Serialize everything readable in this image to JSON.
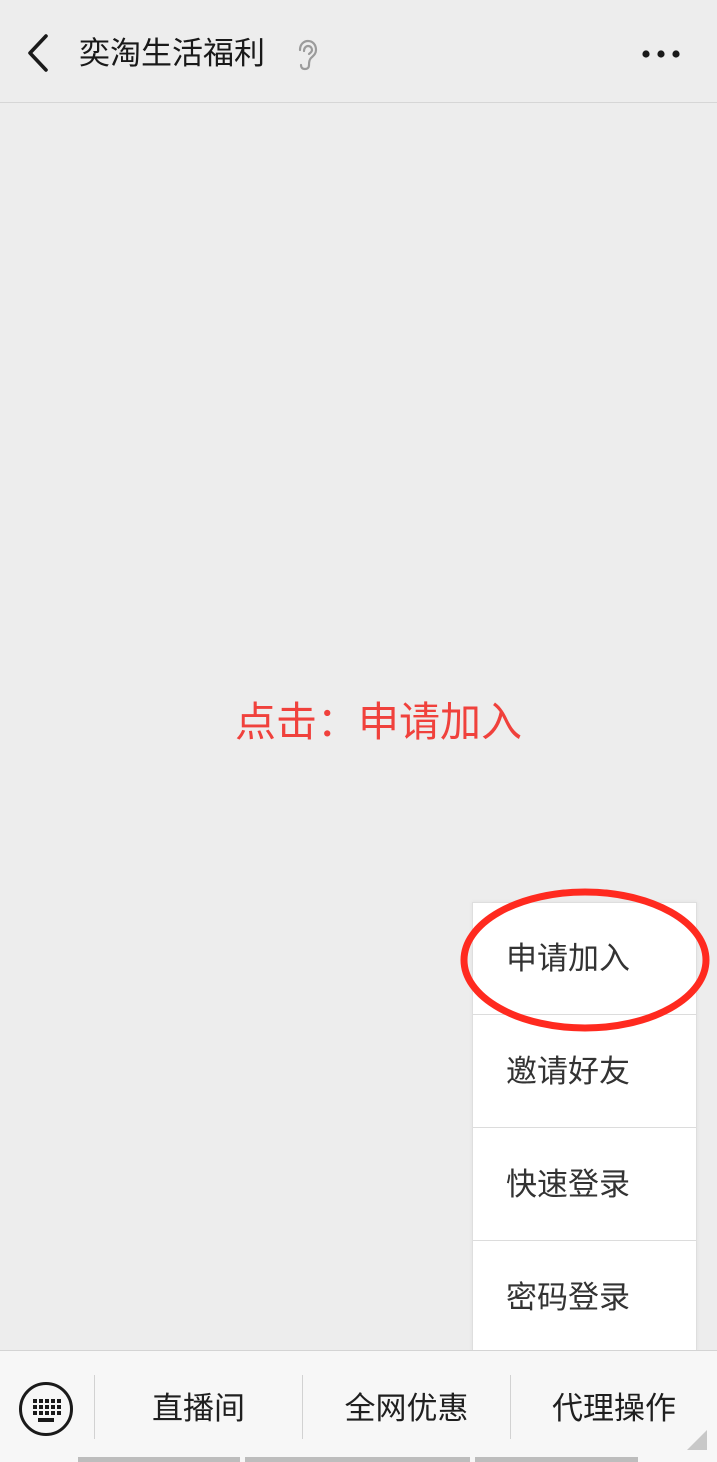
{
  "navbar": {
    "title": "奕淘生活福利",
    "back_icon": "chevron-left-icon",
    "ear_icon": "ear-icon",
    "more_icon": "more-dots-icon"
  },
  "content": {
    "instruction": "点击：申请加入",
    "instruction_color": "#f0413c"
  },
  "popup_menu": {
    "items": [
      {
        "label": "申请加入",
        "highlighted": true
      },
      {
        "label": "邀请好友"
      },
      {
        "label": "快速登录"
      },
      {
        "label": "密码登录"
      }
    ],
    "highlight_color": "#ff2a1f"
  },
  "bottom_menu": {
    "keyboard_icon": "keyboard-icon",
    "tabs": [
      {
        "label": "直播间"
      },
      {
        "label": "全网优惠"
      },
      {
        "label": "代理操作",
        "active": true
      }
    ]
  }
}
